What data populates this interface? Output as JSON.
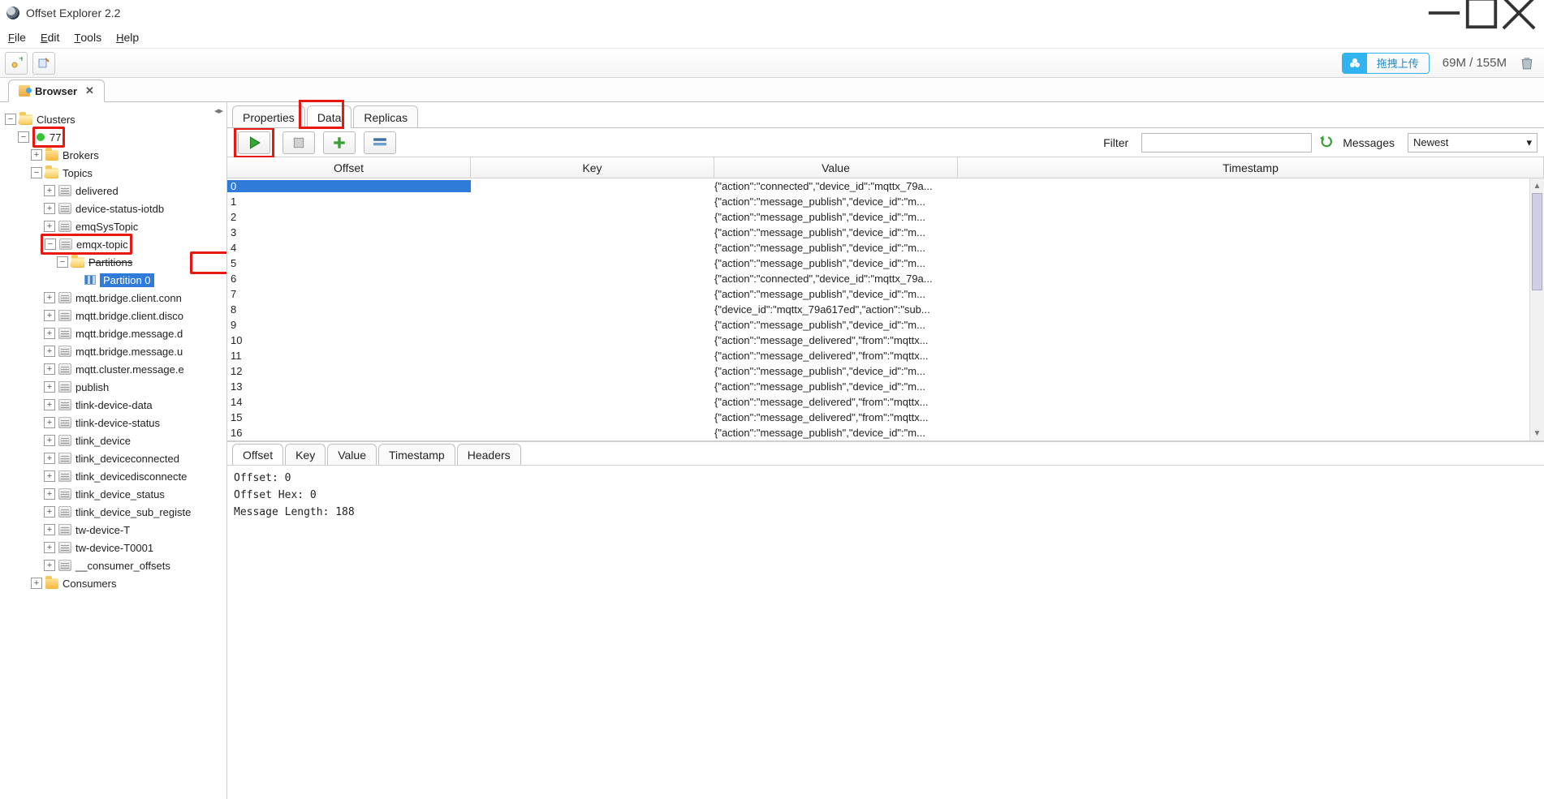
{
  "window": {
    "title": "Offset Explorer  2.2"
  },
  "menu": {
    "file": "File",
    "edit": "Edit",
    "tools": "Tools",
    "help": "Help"
  },
  "toolbar": {
    "upload_label": "拖拽上传",
    "memory": "69M / 155M"
  },
  "browserTab": {
    "label": "Browser"
  },
  "tree": {
    "root": "Clusters",
    "cluster": "77",
    "brokers": "Brokers",
    "topics": "Topics",
    "topicList": [
      "delivered",
      "device-status-iotdb",
      "emqSysTopic"
    ],
    "emqx": "emqx-topic",
    "partitions": "Partitions",
    "partition0": "Partition 0",
    "rest": [
      "mqtt.bridge.client.conn",
      "mqtt.bridge.client.disco",
      "mqtt.bridge.message.d",
      "mqtt.bridge.message.u",
      "mqtt.cluster.message.e",
      "publish",
      "tlink-device-data",
      "tlink-device-status",
      "tlink_device",
      "tlink_deviceconnected",
      "tlink_devicedisconnecte",
      "tlink_device_status",
      "tlink_device_sub_registe",
      "tw-device-T",
      "tw-device-T0001",
      "__consumer_offsets"
    ],
    "consumers": "Consumers"
  },
  "subtabs": {
    "properties": "Properties",
    "data": "Data",
    "replicas": "Replicas"
  },
  "action": {
    "filter": "Filter",
    "messages": "Messages",
    "messagesSel": "Newest"
  },
  "grid": {
    "cols": {
      "offset": "Offset",
      "key": "Key",
      "value": "Value",
      "timestamp": "Timestamp"
    },
    "rows": [
      {
        "o": "0",
        "v": "{\"action\":\"connected\",\"device_id\":\"mqttx_79a..."
      },
      {
        "o": "1",
        "v": "{\"action\":\"message_publish\",\"device_id\":\"m..."
      },
      {
        "o": "2",
        "v": "{\"action\":\"message_publish\",\"device_id\":\"m..."
      },
      {
        "o": "3",
        "v": "{\"action\":\"message_publish\",\"device_id\":\"m..."
      },
      {
        "o": "4",
        "v": "{\"action\":\"message_publish\",\"device_id\":\"m..."
      },
      {
        "o": "5",
        "v": "{\"action\":\"message_publish\",\"device_id\":\"m..."
      },
      {
        "o": "6",
        "v": "{\"action\":\"connected\",\"device_id\":\"mqttx_79a..."
      },
      {
        "o": "7",
        "v": "{\"action\":\"message_publish\",\"device_id\":\"m..."
      },
      {
        "o": "8",
        "v": "{\"device_id\":\"mqttx_79a617ed\",\"action\":\"sub..."
      },
      {
        "o": "9",
        "v": "{\"action\":\"message_publish\",\"device_id\":\"m..."
      },
      {
        "o": "10",
        "v": "{\"action\":\"message_delivered\",\"from\":\"mqttx..."
      },
      {
        "o": "11",
        "v": "{\"action\":\"message_delivered\",\"from\":\"mqttx..."
      },
      {
        "o": "12",
        "v": "{\"action\":\"message_publish\",\"device_id\":\"m..."
      },
      {
        "o": "13",
        "v": "{\"action\":\"message_publish\",\"device_id\":\"m..."
      },
      {
        "o": "14",
        "v": "{\"action\":\"message_delivered\",\"from\":\"mqttx..."
      },
      {
        "o": "15",
        "v": "{\"action\":\"message_delivered\",\"from\":\"mqttx..."
      },
      {
        "o": "16",
        "v": "{\"action\":\"message_publish\",\"device_id\":\"m..."
      }
    ]
  },
  "detailTabs": {
    "offset": "Offset",
    "key": "Key",
    "value": "Value",
    "timestamp": "Timestamp",
    "headers": "Headers"
  },
  "detail": {
    "l1": "Offset: 0",
    "l2": "Offset Hex: 0",
    "l3": "Message Length: 188"
  }
}
